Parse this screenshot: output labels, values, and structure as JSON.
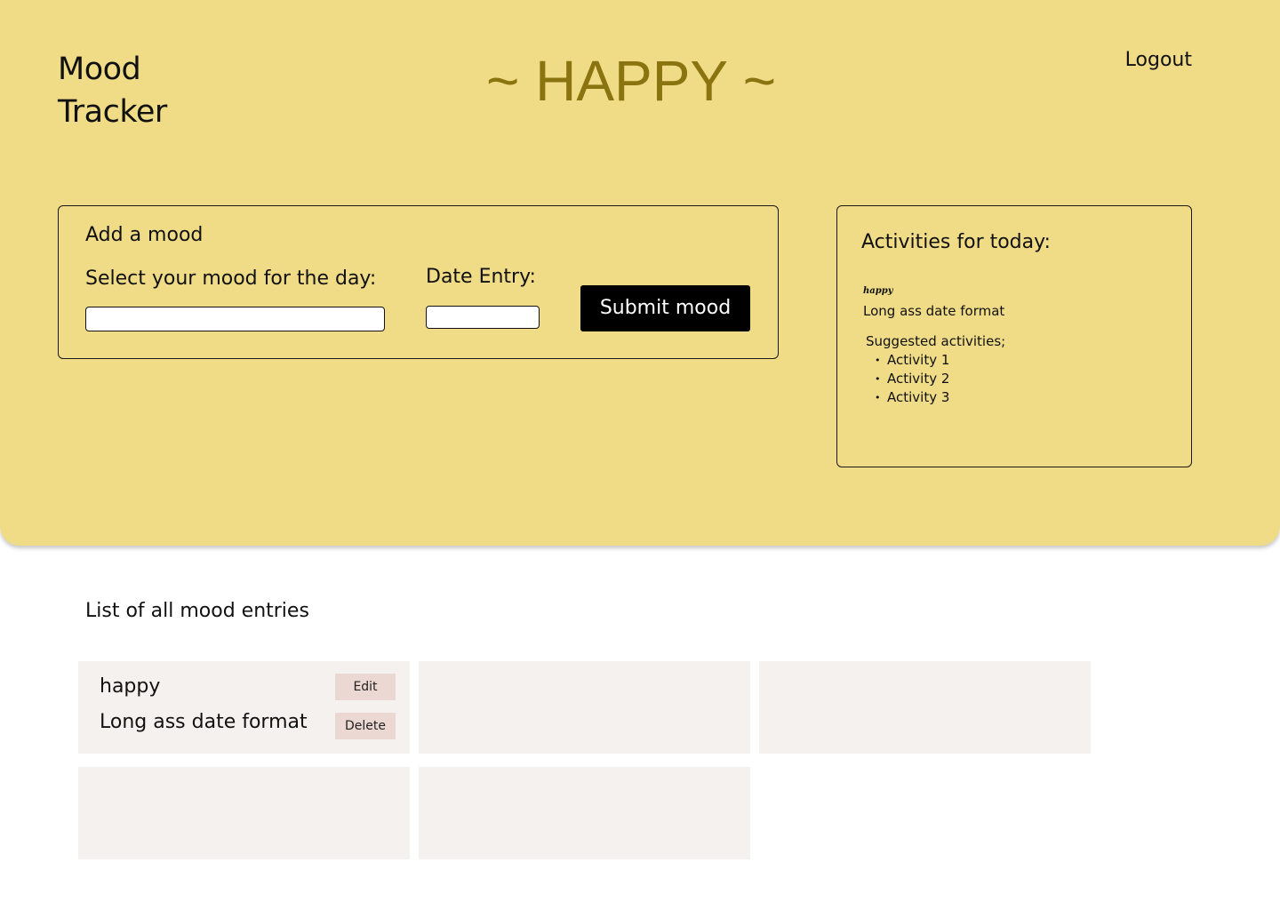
{
  "header": {
    "brand_line1": "Mood",
    "brand_line2": "Tracker",
    "current_mood": "~ HAPPY ~",
    "logout_label": "Logout"
  },
  "add_mood": {
    "title": "Add a mood",
    "mood_label": "Select your mood for the day:",
    "mood_value": "",
    "date_label": "Date Entry:",
    "date_value": "",
    "submit_label": "Submit mood"
  },
  "activities": {
    "title": "Activities for today:",
    "mood": "happy",
    "date": "Long ass date format",
    "suggested_label": "Suggested activities;",
    "items": [
      "Activity 1",
      "Activity 2",
      "Activity 3"
    ]
  },
  "entries": {
    "title": "List of all mood entries",
    "items": [
      {
        "mood": "happy",
        "date": "Long ass date format",
        "edit_label": "Edit",
        "delete_label": "Delete"
      }
    ]
  },
  "colors": {
    "hero_bg": "#f0dc86",
    "mood_text": "#8a7410",
    "card_bg": "#f5f1ee",
    "button_bg": "#ecd8d2",
    "submit_bg": "#000000"
  }
}
